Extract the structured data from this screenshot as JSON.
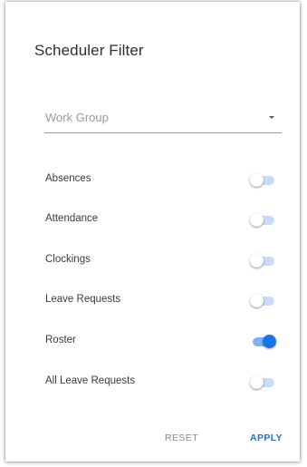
{
  "dialog": {
    "title": "Scheduler Filter"
  },
  "work_group": {
    "placeholder": "Work Group"
  },
  "filters": [
    {
      "label": "Absences",
      "on": false
    },
    {
      "label": "Attendance",
      "on": false
    },
    {
      "label": "Clockings",
      "on": false
    },
    {
      "label": "Leave Requests",
      "on": false
    },
    {
      "label": "Roster",
      "on": true
    },
    {
      "label": "All Leave Requests",
      "on": false
    }
  ],
  "actions": {
    "reset_label": "RESET",
    "apply_label": "APPLY"
  },
  "colors": {
    "accent": "#1a73e8",
    "switch_track_off": "#c9dcf7",
    "switch_track_on": "#7eb3f3"
  },
  "icons": {
    "dropdown": "chevron-down-icon"
  }
}
